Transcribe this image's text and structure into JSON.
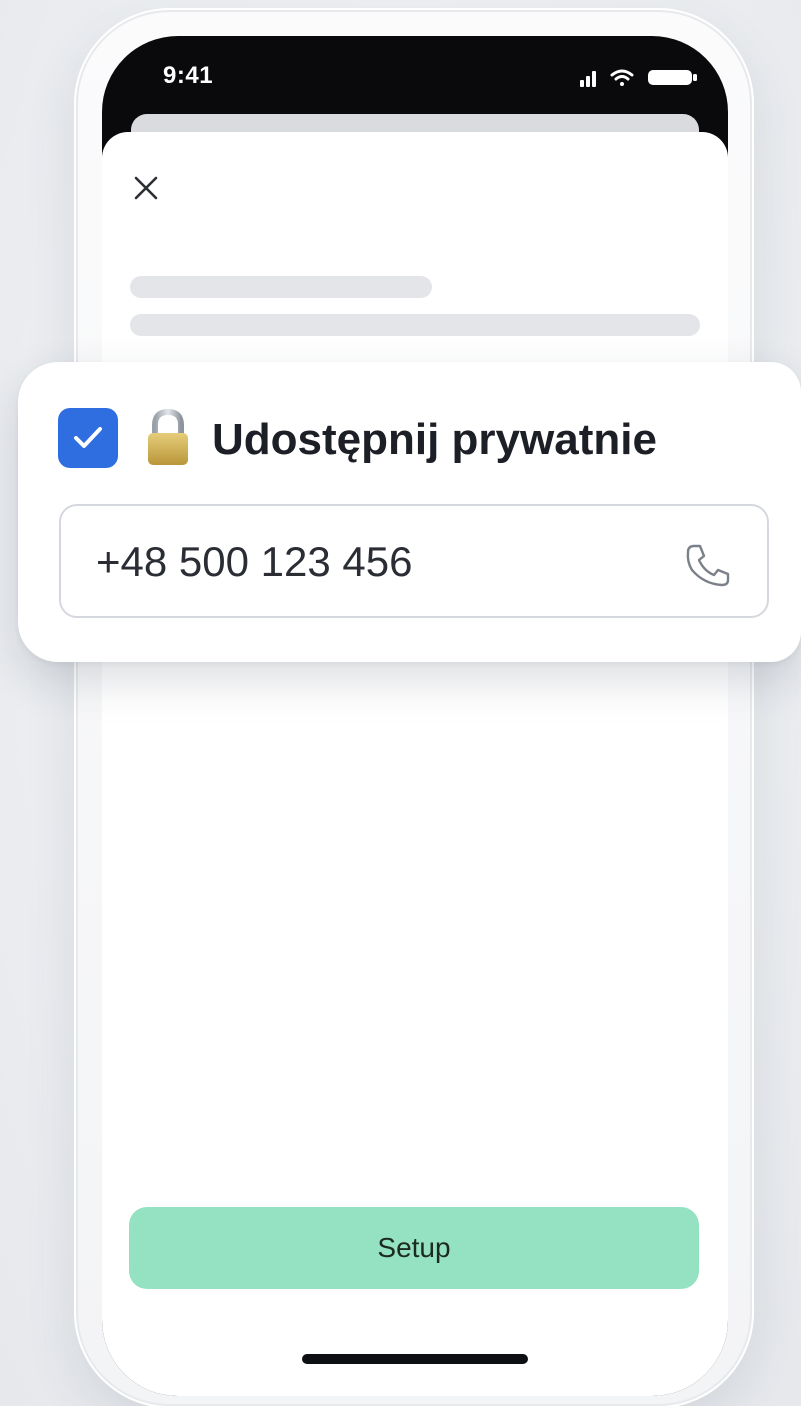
{
  "status_bar": {
    "time": "9:41",
    "icons": [
      "signal-icon",
      "wifi-icon",
      "battery-icon"
    ]
  },
  "sheet": {
    "close_icon": "close-icon"
  },
  "card": {
    "checkbox_checked": true,
    "lock_icon": "lock-icon",
    "title": "Udostępnij prywatnie",
    "phone_value": "+48 500 123 456",
    "phone_icon": "phone-icon"
  },
  "footer": {
    "setup_label": "Setup"
  },
  "colors": {
    "accent_blue": "#2f6ee0",
    "setup_green": "#94e2c2",
    "skeleton": "#e3e5e9"
  }
}
